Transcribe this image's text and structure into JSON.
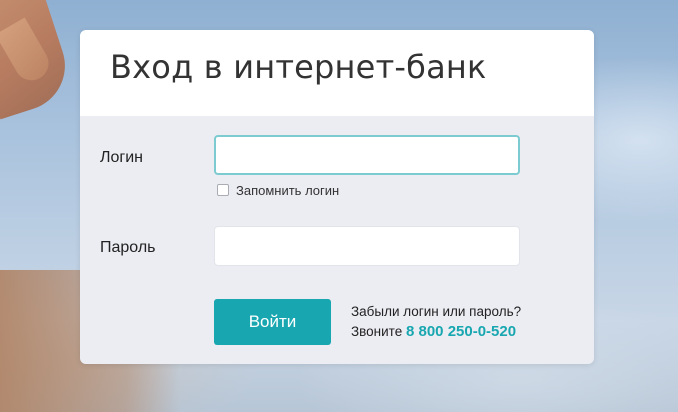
{
  "login_card": {
    "title": "Вход в интернет-банк",
    "login": {
      "label": "Логин",
      "value": "",
      "remember_label": "Запомнить логин"
    },
    "password": {
      "label": "Пароль",
      "value": ""
    },
    "submit_label": "Войти",
    "help": {
      "forgot_text": "Забыли логин или пароль?",
      "call_text": "Звоните",
      "phone": "8 800 250-0-520"
    }
  },
  "colors": {
    "accent": "#18a7b0",
    "focus_border": "#7ccbd0",
    "card_body_bg": "#ecedf3",
    "header_bg": "#ffffff"
  }
}
